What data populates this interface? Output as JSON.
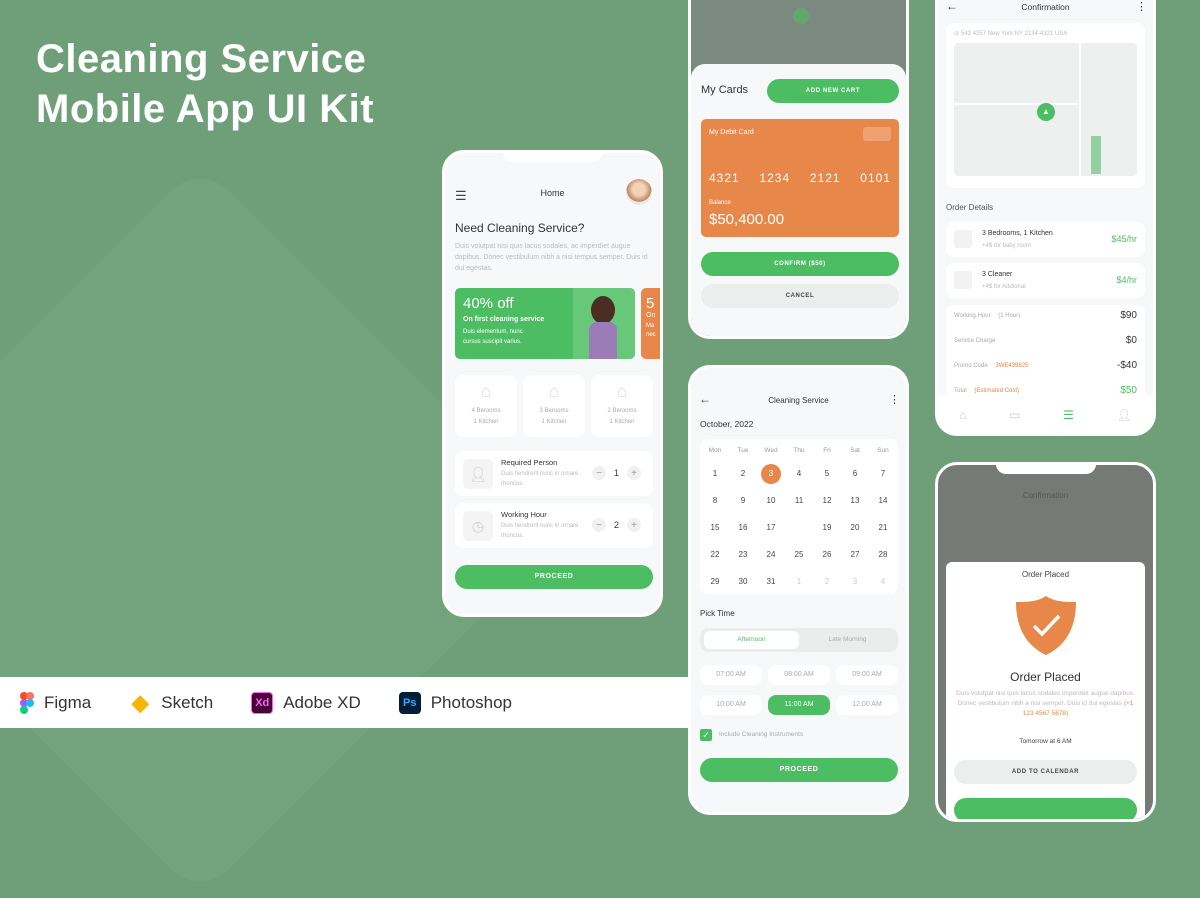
{
  "hero": {
    "title_line1": "Cleaning Service",
    "title_line2": "Mobile App UI Kit"
  },
  "tools": [
    {
      "label": "Figma",
      "icon": "figma-icon"
    },
    {
      "label": "Sketch",
      "icon": "sketch-icon",
      "glyph": "◆"
    },
    {
      "label": "Adobe XD",
      "icon": "xd-icon",
      "glyph": "Xd"
    },
    {
      "label": "Photoshop",
      "icon": "photoshop-icon",
      "glyph": "Ps"
    }
  ],
  "colors": {
    "accent": "#4dbd63",
    "orange": "#e8874a",
    "background": "#6f9f79"
  },
  "home": {
    "title": "Home",
    "heading": "Need Cleaning Service?",
    "desc": "Duis volutpat nisi quis lacus sodales, ac imperdiet augue dapibus. Donec vestibulum nibh a nisi tempus semper. Duis id dui egestas.",
    "promo": {
      "big": "40% off",
      "sub": "On first cleaning service",
      "desc": "Duis elementum, nunc cursus suscipit varius."
    },
    "promo2": {
      "big": "5",
      "sub": "On",
      "desc": "Ma nec"
    },
    "rooms": [
      {
        "l1": "4 Berooms",
        "l2": "1 Kitchen"
      },
      {
        "l1": "3 Berooms",
        "l2": "1 Kitchen"
      },
      {
        "l1": "2 Berooms",
        "l2": "1 Kitchen"
      }
    ],
    "required": {
      "title": "Required Person",
      "desc": "Duis hendrerit nunc in ornare rhoncus.",
      "value": "1"
    },
    "hours": {
      "title": "Working Hour",
      "desc": "Duis hendrerit nunc in ornare rhoncus.",
      "value": "2"
    },
    "proceed": "PROCEED"
  },
  "cards": {
    "title": "My Cards",
    "add": "ADD NEW CART",
    "card_label": "My Debit Card",
    "numbers": [
      "4321",
      "1234",
      "2121",
      "0101"
    ],
    "balance_label": "Balance",
    "balance": "$50,400.00",
    "confirm": "CONFIRM ($50)",
    "cancel": "CANCEL"
  },
  "calendar": {
    "title": "Cleaning Service",
    "month": "October, 2022",
    "weekdays": [
      "Mon",
      "Tue",
      "Wed",
      "Thu",
      "Fri",
      "Sat",
      "Sun"
    ],
    "days": [
      [
        "1",
        "2",
        "3",
        "4",
        "5",
        "6",
        "7"
      ],
      [
        "8",
        "9",
        "10",
        "11",
        "12",
        "13",
        "14"
      ],
      [
        "15",
        "16",
        "17",
        "",
        "19",
        "20",
        "21"
      ],
      [
        "22",
        "23",
        "24",
        "25",
        "26",
        "27",
        "28"
      ],
      [
        "29",
        "30",
        "31",
        "1",
        "2",
        "3",
        "4"
      ]
    ],
    "selected": "3",
    "pick_time": "Pick Time",
    "tabs": [
      "Afternoon",
      "Late Morning"
    ],
    "active_tab": "Afternoon",
    "slots": [
      "07:00 AM",
      "08:00 AM",
      "09:00 AM",
      "10:00 AM",
      "11:00 AM",
      "12:00 AM"
    ],
    "selected_slot": "11:00 AM",
    "checkbox": "Include Cleaning Instruments",
    "checked": true,
    "proceed": "PROCEED"
  },
  "confirm": {
    "title": "Confirmation",
    "address": "543 4357 New York NY 2134-4321 USA",
    "order_details": "Order Details",
    "items": [
      {
        "title": "3 Bedrooms, 1 Kitchen",
        "sub": "+4$ for baby room",
        "price": "$45/hr"
      },
      {
        "title": "3 Cleaner",
        "sub": "+4$ for Addional",
        "price": "$4/hr"
      }
    ],
    "rows": [
      {
        "label": "Working Hour",
        "extra": "(1 Hour)",
        "value": "$90"
      },
      {
        "label": "Service Charge",
        "extra": "",
        "value": "$0"
      },
      {
        "label": "Promo Code",
        "extra": "3WE439825",
        "value": "-$40"
      },
      {
        "label": "Total",
        "extra": "(Estimated Cost)",
        "value": "$50"
      }
    ]
  },
  "placed": {
    "header": "Confirmation",
    "sheet_title": "Order Placed",
    "heading": "Order Placed",
    "desc": "Duis volutpat nisi quis lacus sodales imperdiet augue dapibus. Donec vestibulum nibh a nisi semper. Duis id dui egestas",
    "phone": "(+1 123 4567 5678)",
    "when": "Tomorrow at 6 AM",
    "add_calendar": "ADD TO CALENDAR"
  }
}
